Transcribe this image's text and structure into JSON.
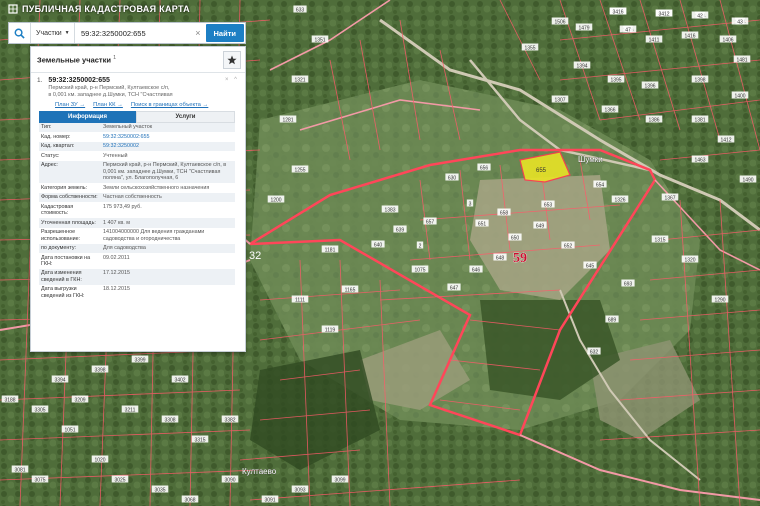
{
  "app": {
    "title": "ПУБЛИЧНАЯ КАДАСТРОВАЯ КАРТА"
  },
  "search": {
    "type_label": "Участки",
    "query": "59:32:3250002:655",
    "clear": "×",
    "find_label": "Найти"
  },
  "panel": {
    "title": "Земельные участки",
    "count": "1",
    "result": {
      "index": "1.",
      "cad_number": "59:32:3250002:655",
      "address": "Пермский край, р-н Пермский, Култаевское с/п, в 0,001 км. западнее д.Шумки, ТСН \"Счастливая",
      "controls": "× ^",
      "links": [
        "План ЗУ →",
        "План КК →",
        "Поиск в границах объекта →"
      ]
    },
    "tabs": [
      "Информация",
      "Услуги"
    ],
    "rows": [
      {
        "key": "Тип:",
        "value": "Земельный участок",
        "link": false
      },
      {
        "key": "Кад. номер:",
        "value": "59:32:3250002:655",
        "link": true
      },
      {
        "key": "Кад. квартал:",
        "value": "59:32:3250002",
        "link": true
      },
      {
        "key": "Статус:",
        "value": "Учтенный",
        "link": false
      },
      {
        "key": "Адрес:",
        "value": "Пермский край, р-н Пермский, Култаевское с/п, в 0,001 км. западнее д.Шумки, ТСН \"Счастливая поляна\", ул. Благополучная, 6",
        "link": false
      },
      {
        "key": "Категория земель:",
        "value": "Земли сельскохозяйственного назначения",
        "link": false
      },
      {
        "key": "Форма собственности:",
        "value": "Частная собственность",
        "link": false
      },
      {
        "key": "Кадастровая стоимость:",
        "value": "175 973,49 руб.",
        "link": false
      },
      {
        "key": "Уточненная площадь:",
        "value": "1 407 кв. м",
        "link": false
      },
      {
        "key": "Разрешенное использование:",
        "value": "141004000000 Для ведения гражданами садоводства и огородничества",
        "link": false
      },
      {
        "key": "по документу:",
        "value": "Для садоводства",
        "link": false
      },
      {
        "key": "Дата постановки на ГКН:",
        "value": "09.02.2011",
        "link": false
      },
      {
        "key": "Дата изменения сведений в ГКН:",
        "value": "17.12.2015",
        "link": false
      },
      {
        "key": "Дата выгрузки сведений из ГКН:",
        "value": "18.12.2015",
        "link": false
      }
    ]
  },
  "map": {
    "region_label": "59",
    "quarter_label": "32",
    "village_label_shumki": "Шумки",
    "village_label_kultaevo": "Култаево",
    "selected_lot_label": "655",
    "lot_labels": [
      "1495",
      "1452",
      "1464",
      "1424",
      "1436",
      "1411",
      "1416",
      "1406",
      "1481",
      "1479",
      "1506",
      "1355",
      "1394",
      "1395",
      "1396",
      "1398",
      "1400",
      "1307",
      "1366",
      "1386",
      "1381",
      "1412",
      "1490",
      "1463",
      "1367",
      "1326",
      "1315",
      "1320",
      "1290",
      "1383",
      "2",
      "3",
      "654",
      "658",
      "653",
      "652",
      "651",
      "650",
      "649",
      "648",
      "646",
      "647",
      "645",
      "657",
      "639",
      "640",
      "693",
      "689",
      "632",
      "656",
      "630",
      "633",
      "1351",
      "1321",
      "1281",
      "1255",
      "1200",
      "1181",
      "1165",
      "1119",
      "1111",
      "1075",
      "1051",
      "1020",
      "3025",
      "3035",
      "3068",
      "3075",
      "3081",
      "3090",
      "3091",
      "3093",
      "3099",
      "3188",
      "3305",
      "3209",
      "3211",
      "3308",
      "3315",
      "3382",
      "3394",
      "3398",
      "3399",
      "3402",
      "3411",
      "3416",
      "3412",
      "42",
      "43",
      "47"
    ],
    "colors": {
      "boundary": "#ff3b4e",
      "region_boundary": "#f2a0a8",
      "selected_fill": "#e8e326",
      "label_bg": "#ffffff"
    }
  }
}
